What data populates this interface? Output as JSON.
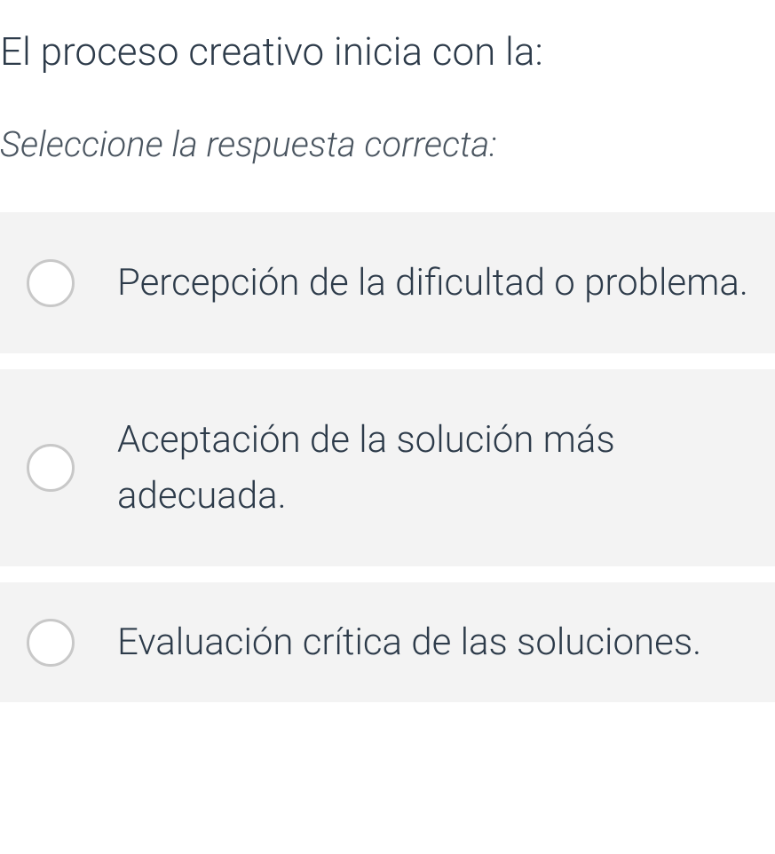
{
  "question": {
    "text": "El proceso creativo inicia con la:",
    "instruction": "Seleccione la respuesta correcta:"
  },
  "options": [
    {
      "label": "Percepción de la dificultad o problema."
    },
    {
      "label": "Aceptación de la solución más adecuada."
    },
    {
      "label": "Evaluación crítica de las soluciones."
    }
  ]
}
